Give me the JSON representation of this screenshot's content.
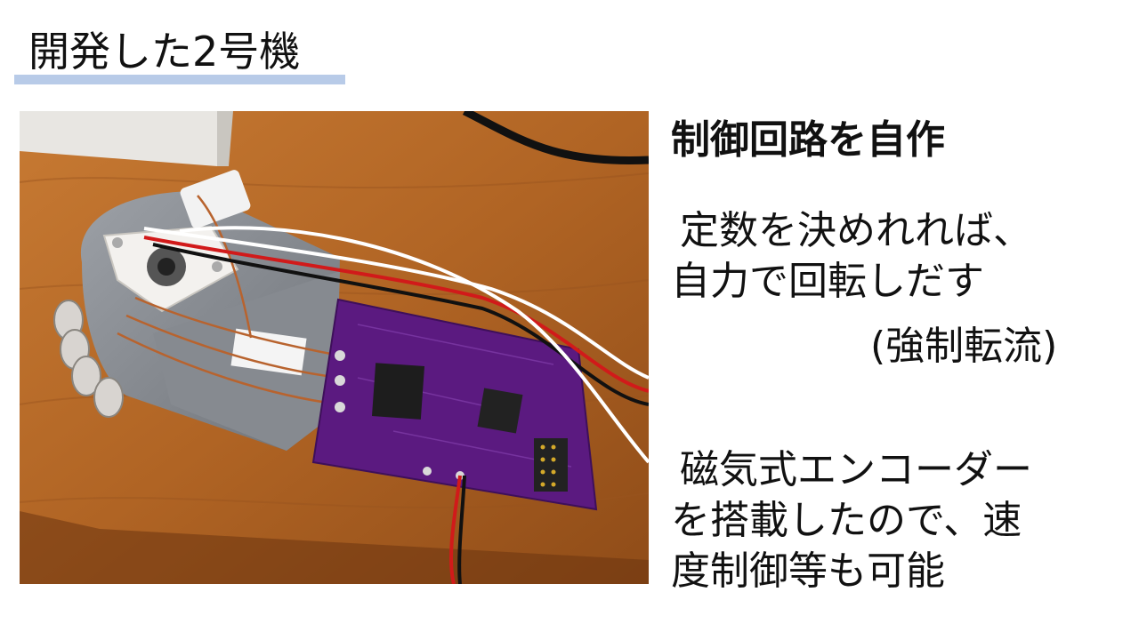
{
  "slide": {
    "title": "開発した2号機",
    "heading": "制御回路を自作",
    "text1_line1": "定数を決めれれば、",
    "text1_line2": "自力で回転しだす",
    "text1_line3": "(強制転流)",
    "text2_line1": "磁気式エンコーダー",
    "text2_line2": "を搭載したので、速",
    "text2_line3": "度制御等も可能"
  },
  "colors": {
    "title_underline": "#b8cbe8",
    "pcb": "#5b1a80",
    "wood": "#b56a28"
  }
}
